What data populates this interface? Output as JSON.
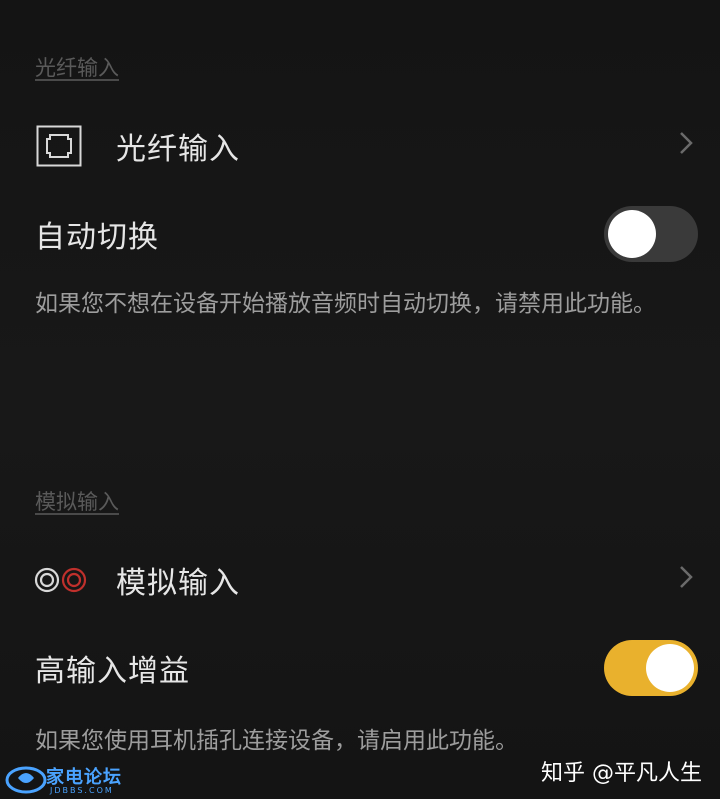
{
  "optical_section": {
    "header": "光纤输入",
    "input_row": {
      "label": "光纤输入",
      "icon": "optical-port-icon"
    },
    "auto_switch": {
      "label": "自动切换",
      "enabled": false,
      "description": "如果您不想在设备开始播放音频时自动切换，请禁用此功能。"
    }
  },
  "analog_section": {
    "header": "模拟输入",
    "input_row": {
      "label": "模拟输入",
      "icon": "analog-rca-icon"
    },
    "high_gain": {
      "label": "高输入增益",
      "enabled": true,
      "description": "如果您使用耳机插孔连接设备，请启用此功能。"
    }
  },
  "colors": {
    "accent": "#e9b12d",
    "background": "#161616",
    "toggle_off": "#3a3a3a"
  },
  "watermarks": {
    "left_brand": "家电论坛",
    "left_url": "JDBBS.COM",
    "right_text": "知乎 @平凡人生"
  }
}
